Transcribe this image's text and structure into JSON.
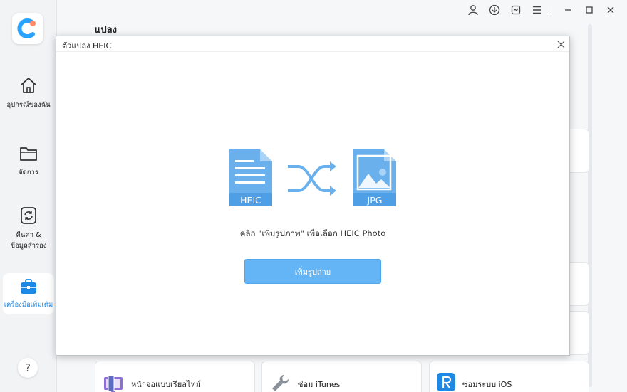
{
  "sidebar": {
    "items": [
      {
        "label": "อุปกรณ์ของฉัน",
        "icon": "home-icon"
      },
      {
        "label": "จัดการ",
        "icon": "folder-icon"
      },
      {
        "label": "คืนค่า &\nข้อมูลสำรอง",
        "icon": "backup-restore-icon"
      },
      {
        "label": "เครื่องมือเพิ่มเติม",
        "icon": "toolbox-icon"
      }
    ],
    "help": "?"
  },
  "main": {
    "title": "แปลง",
    "tools": [
      {
        "label": "หน้าจอแบบเรียลไทม์",
        "icon": "realtime-screen-icon"
      },
      {
        "label": "ซ่อม iTunes",
        "icon": "wrench-icon"
      },
      {
        "label": "ซ่อมระบบ iOS",
        "icon": "ios-repair-icon"
      }
    ]
  },
  "dialog": {
    "title": "ตัวแปลง HEIC",
    "source_format": "HEIC",
    "target_format": "JPG",
    "hint": "คลิก \"เพิ่มรูปภาพ\" เพื่อเลือก HEIC Photo",
    "button_label": "เพิ่มรูปถ่าย"
  },
  "colors": {
    "accent": "#1e88e5",
    "illustration": "#6ab0ec",
    "button": "#64b5f6"
  }
}
